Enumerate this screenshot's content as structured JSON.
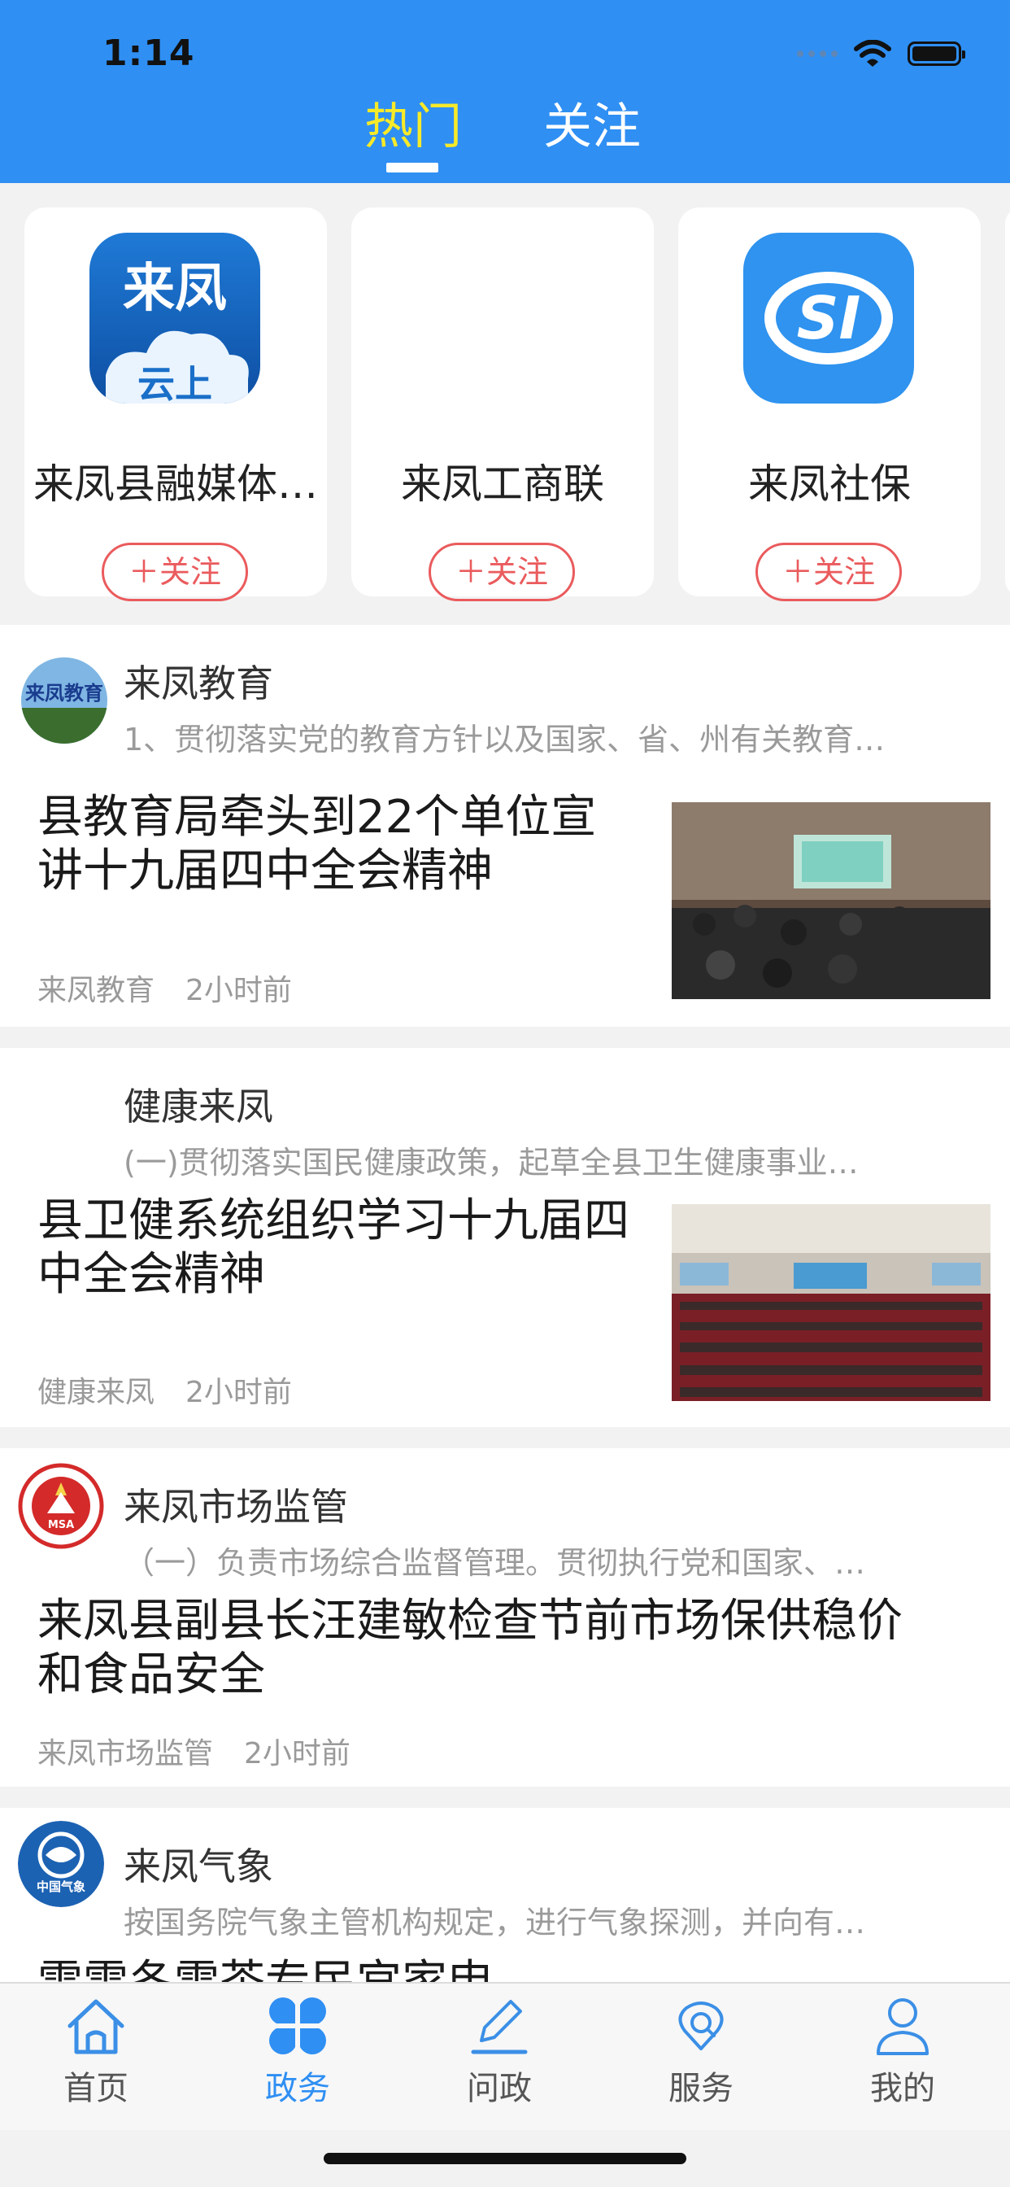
{
  "status_bar": {
    "time": "1:14"
  },
  "top_tabs": [
    {
      "label": "热门",
      "active": true
    },
    {
      "label": "关注",
      "active": false
    }
  ],
  "recommended": [
    {
      "name": "来凤县融媒体…",
      "logo_text_top": "来凤",
      "logo_text_bottom": "云上",
      "follow_label": "＋关注"
    },
    {
      "name": "来凤工商联",
      "follow_label": "＋关注"
    },
    {
      "name": "来凤社保",
      "logo_text": "SI",
      "follow_label": "＋关注"
    }
  ],
  "feed": [
    {
      "source_name": "来凤教育",
      "avatar_text": "来凤教育",
      "source_desc": "1、贯彻落实党的教育方针以及国家、省、州有关教育…",
      "headline_lines": [
        "县教育局牵头到22个单位宣",
        "讲十九届四中全会精神"
      ],
      "meta_source": "来凤教育",
      "meta_time": "2小时前"
    },
    {
      "source_name": "健康来凤",
      "source_desc": "(一)贯彻落实国民健康政策，起草全县卫生健康事业…",
      "headline_lines": [
        "县卫健系统组织学习十九届四",
        "中全会精神"
      ],
      "meta_source": "健康来凤",
      "meta_time": "2小时前"
    },
    {
      "source_name": "来凤市场监管",
      "avatar_text": "MSA",
      "source_desc": "（一）负责市场综合监督管理。贯彻执行党和国家、…",
      "headline_lines": [
        "来凤县副县长汪建敏检查节前市场保供稳价",
        "和食品安全"
      ],
      "meta_source": "来凤市场监管",
      "meta_time": "2小时前"
    },
    {
      "source_name": "来凤气象",
      "avatar_text": "中国气象",
      "source_desc": "按国务院气象主管机构规定，进行气象探测，并向有…",
      "headline_partial": "雷雷冬雪茶专民宫家申"
    }
  ],
  "tabbar": [
    {
      "label": "首页",
      "icon": "home-icon",
      "active": false
    },
    {
      "label": "政务",
      "icon": "government-icon",
      "active": true
    },
    {
      "label": "问政",
      "icon": "pencil-icon",
      "active": false
    },
    {
      "label": "服务",
      "icon": "service-icon",
      "active": false
    },
    {
      "label": "我的",
      "icon": "person-icon",
      "active": false
    }
  ],
  "colors": {
    "header_blue": "#2f8ff3",
    "active_tab_yellow": "#f7ea28",
    "follow_red": "#ea5b5d",
    "tab_active_blue": "#2f8ff3"
  }
}
